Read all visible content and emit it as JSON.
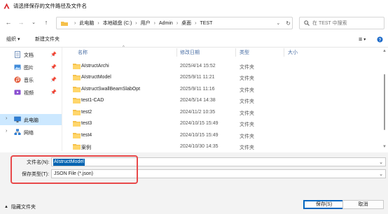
{
  "window": {
    "title": "请选择保存的文件路径及文件名"
  },
  "nav": {
    "breadcrumb": [
      "此电脑",
      "本地磁盘 (C:)",
      "用户",
      "Admin",
      "桌面",
      "TEST"
    ],
    "search_placeholder": "在 TEST 中搜索"
  },
  "toolbar": {
    "organize_label": "组织 ▾",
    "new_folder_label": "新建文件夹"
  },
  "sidebar": {
    "quick": [
      {
        "label": "文档",
        "icon": "documents-icon"
      },
      {
        "label": "图片",
        "icon": "pictures-icon"
      },
      {
        "label": "音乐",
        "icon": "music-icon"
      },
      {
        "label": "视频",
        "icon": "video-icon"
      }
    ],
    "this_pc": "此电脑",
    "network": "网络"
  },
  "columns": {
    "name": "名称",
    "modified": "修改日期",
    "type": "类型",
    "size": "大小"
  },
  "files": [
    {
      "name": "AIstructArchi",
      "modified": "2025/4/14 15:52",
      "type": "文件夹"
    },
    {
      "name": "AIstructModel",
      "modified": "2025/9/11 11:21",
      "type": "文件夹"
    },
    {
      "name": "AIstructSwallBeamSlabOpt",
      "modified": "2025/9/11 11:16",
      "type": "文件夹"
    },
    {
      "name": "test1-CAD",
      "modified": "2024/5/14 14:38",
      "type": "文件夹"
    },
    {
      "name": "test2",
      "modified": "2024/11/2 10:35",
      "type": "文件夹"
    },
    {
      "name": "test3",
      "modified": "2024/10/15 15:49",
      "type": "文件夹"
    },
    {
      "name": "test4",
      "modified": "2024/10/15 15:49",
      "type": "文件夹"
    },
    {
      "name": "案例",
      "modified": "2024/10/30 14:35",
      "type": "文件夹"
    }
  ],
  "form": {
    "filename_label": "文件名(N):",
    "filename_value": "AIstructModel",
    "filetype_label": "保存类型(T):",
    "filetype_value": "JSON File (*.json)"
  },
  "footer": {
    "hide_folders_label": "隐藏文件夹",
    "save_label": "保存(S)",
    "cancel_label": "取消"
  },
  "colors": {
    "accent": "#0067c0",
    "selection": "#0063b1",
    "highlight_box": "#e8494a",
    "folder": "#f5c04a"
  }
}
